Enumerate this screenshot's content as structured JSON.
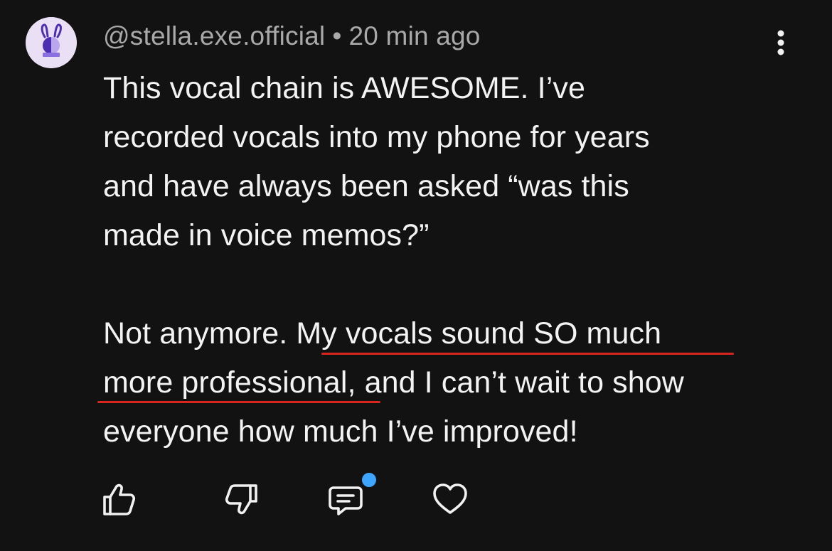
{
  "comment": {
    "author": "@stella.exe.official",
    "separator": "•",
    "timestamp": "20 min ago",
    "lines": [
      "This vocal chain is AWESOME. I’ve",
      "recorded vocals into my phone for years",
      "and have always been asked “was this",
      "made in voice memos?”"
    ],
    "line5_plain": "Not anymore. ",
    "line5_highlight": "My vocals sound SO much",
    "line6_highlight": "more professional",
    "line6_plain": ", and I can’t wait to show",
    "line7": "everyone how much I’ve improved!"
  },
  "actions": [
    {
      "name": "like",
      "icon": "thumbs-up-icon"
    },
    {
      "name": "dislike",
      "icon": "thumbs-down-icon"
    },
    {
      "name": "reply",
      "icon": "reply-comment-icon"
    },
    {
      "name": "heart",
      "icon": "heart-icon"
    }
  ],
  "colors": {
    "background": "#121212",
    "text": "#f3f3f3",
    "meta": "#a9a9a9",
    "underline": "#d8261f",
    "badge": "#3ea6ff",
    "avatar_bg": "#e9e0f6",
    "avatar_accent": "#5b3fc4"
  },
  "menu_icon": "more-vertical-icon",
  "avatar_icon": "bunny-logo-icon"
}
